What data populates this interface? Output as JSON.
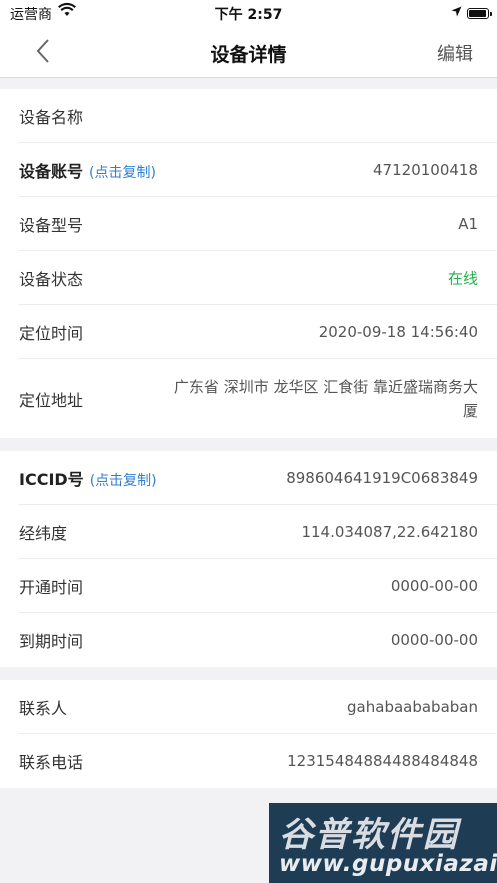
{
  "statusbar": {
    "carrier": "运营商",
    "time": "下午 2:57"
  },
  "nav": {
    "title": "设备详情",
    "edit_label": "编辑"
  },
  "copy_hint": "(点击复制)",
  "group1": [
    {
      "label": "设备名称",
      "value": ""
    },
    {
      "label": "设备账号",
      "value": "47120100418"
    },
    {
      "label": "设备型号",
      "value": "A1"
    },
    {
      "label": "设备状态",
      "value": "在线"
    },
    {
      "label": "定位时间",
      "value": "2020-09-18 14:56:40"
    },
    {
      "label": "定位地址",
      "value": "广东省 深圳市 龙华区 汇食街 靠近盛瑞商务大厦"
    }
  ],
  "group2": [
    {
      "label": "ICCID号",
      "value": "898604641919C0683849"
    },
    {
      "label": "经纬度",
      "value": "114.034087,22.642180"
    },
    {
      "label": "开通时间",
      "value": "0000-00-00"
    },
    {
      "label": "到期时间",
      "value": "0000-00-00"
    }
  ],
  "group3": [
    {
      "label": "联系人",
      "value": "gahabaabababan"
    },
    {
      "label": "联系电话",
      "value": "12315484884488484848"
    }
  ],
  "watermark": {
    "title": "谷普软件园",
    "url": "www.gupuxiazai.com"
  },
  "colors": {
    "online": "#21b34a",
    "copy_link": "#2f7fd1"
  }
}
